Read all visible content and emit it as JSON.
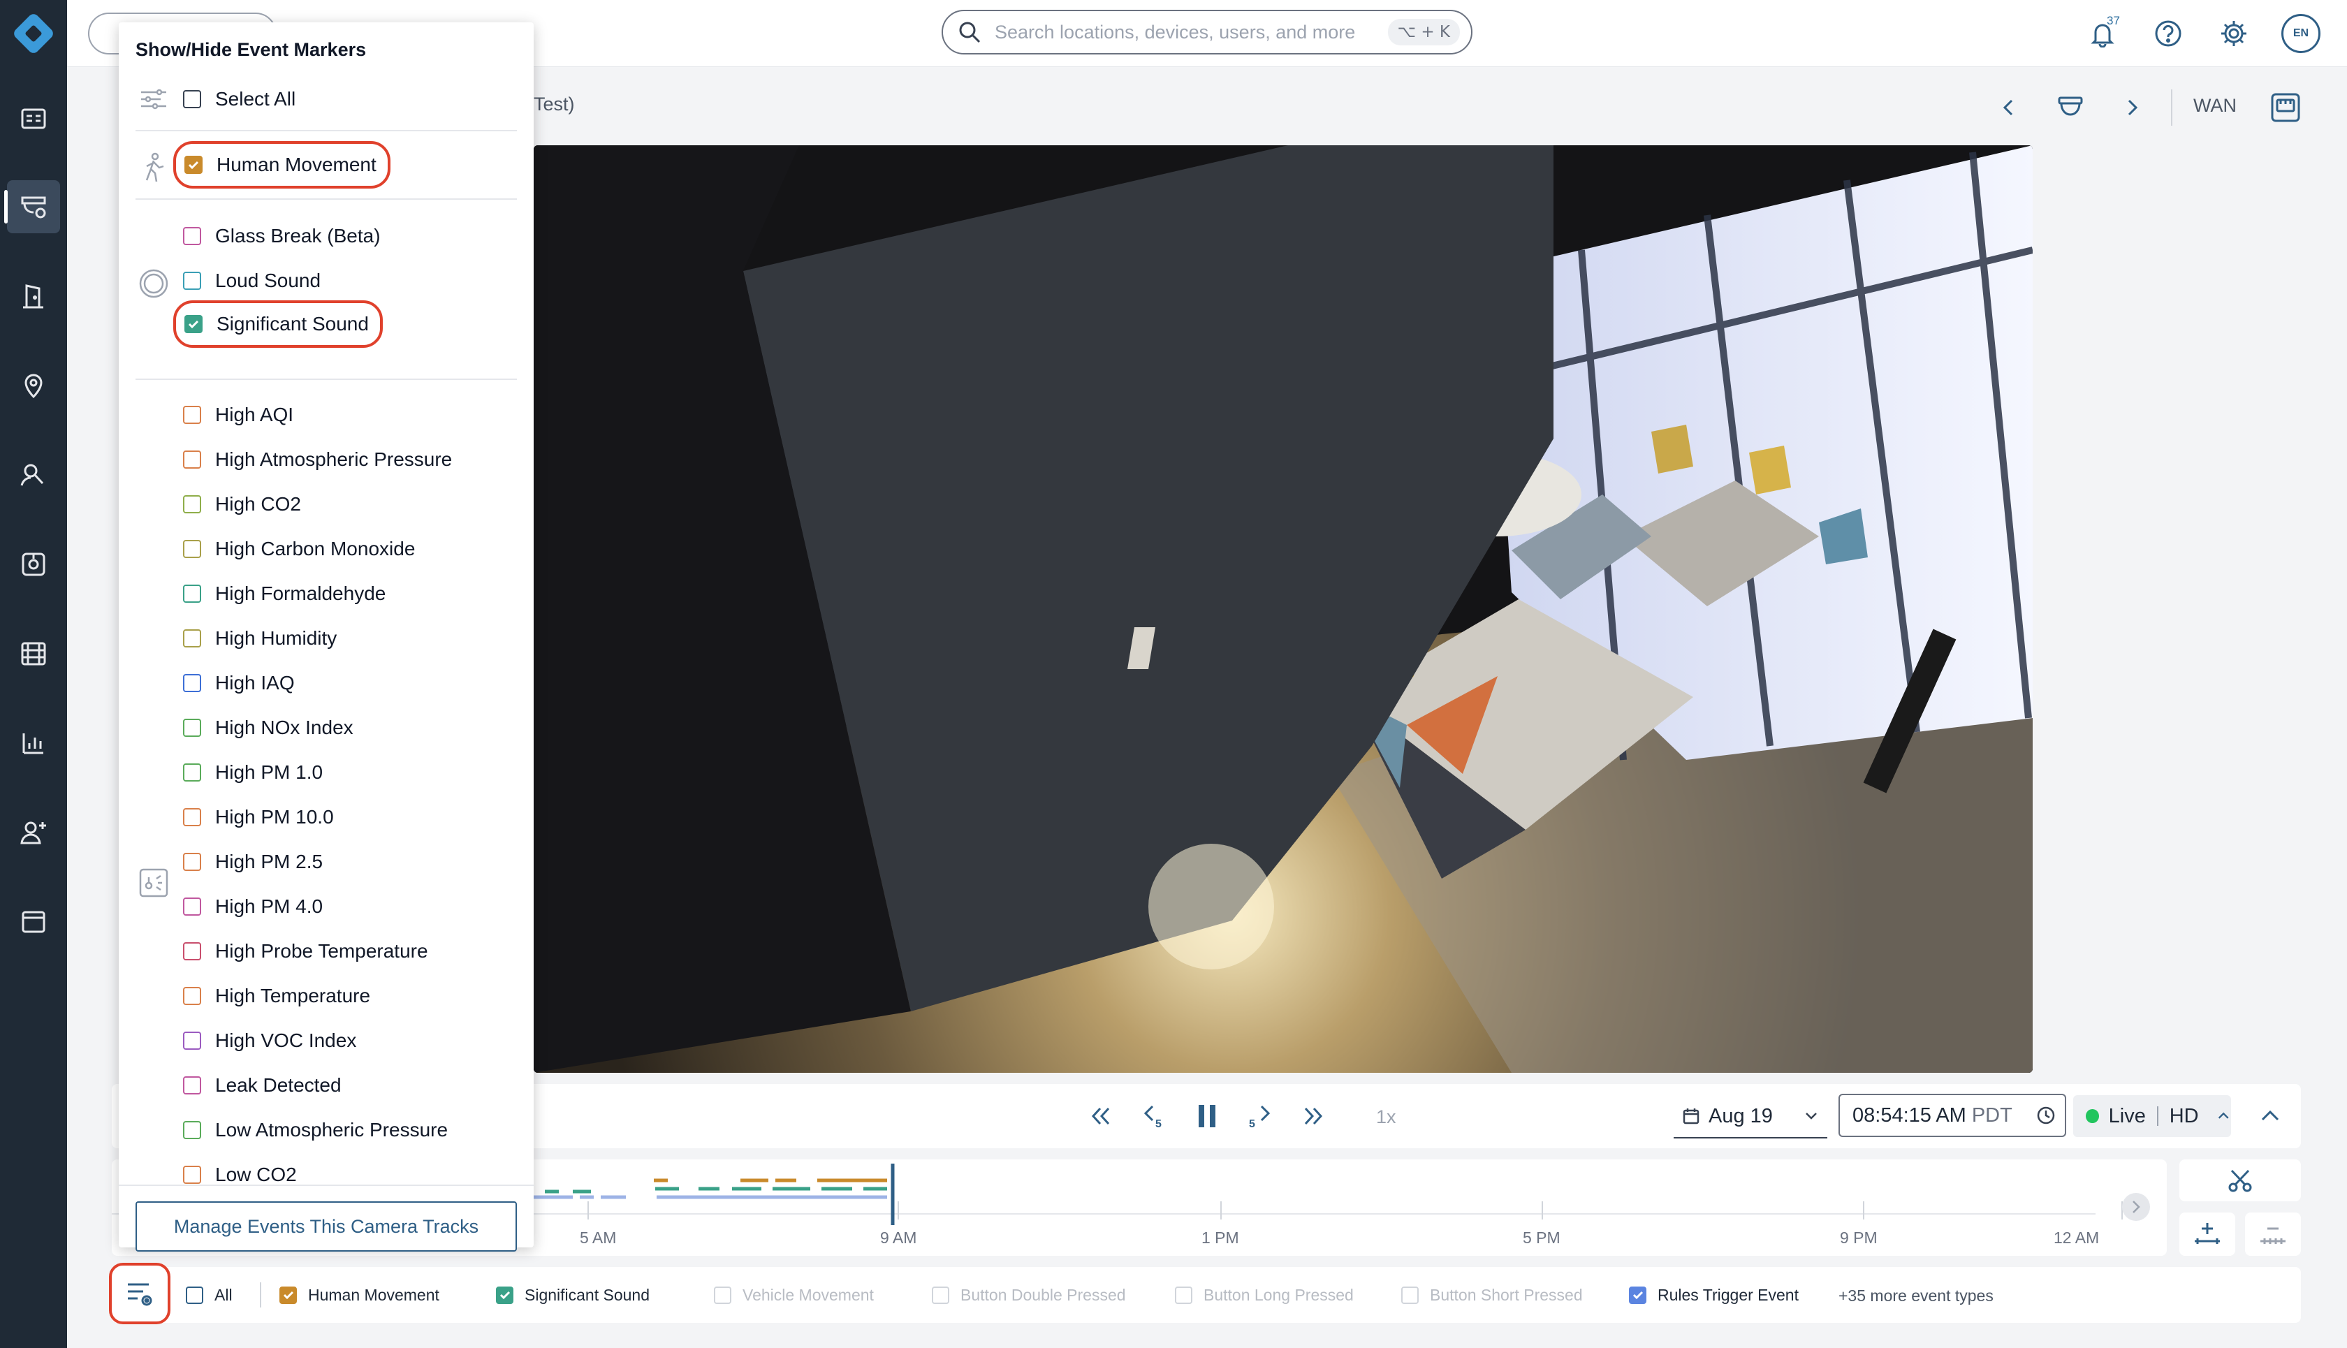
{
  "header": {
    "search": {
      "placeholder": "Search locations, devices, users, and more",
      "shortcut": "⌥ + K"
    },
    "notification_count": "37",
    "avatar_initials": "EN"
  },
  "camera": {
    "title_fragment": "Test)",
    "network_label": "WAN"
  },
  "playback": {
    "speed": "1x",
    "date": "Aug 19",
    "time": "08:54:15 AM",
    "timezone": "PDT",
    "live_label": "Live",
    "quality_label": "HD"
  },
  "timeline": {
    "labels": [
      "5 AM",
      "9 AM",
      "1 PM",
      "5 PM",
      "9 PM",
      "12 AM"
    ]
  },
  "marker_panel": {
    "title": "Show/Hide Event Markers",
    "select_all": "Select All",
    "groups": {
      "motion": [
        {
          "label": "Human Movement",
          "checked": true,
          "color": "#c98a2b"
        }
      ],
      "sound": [
        {
          "label": "Glass Break (Beta)",
          "checked": false,
          "color": "#c0589f"
        },
        {
          "label": "Loud Sound",
          "checked": false,
          "color": "#3a9fb5"
        },
        {
          "label": "Significant Sound",
          "checked": true,
          "color": "#3aa188"
        }
      ],
      "sensor": [
        {
          "label": "High AQI",
          "color": "#d9804a"
        },
        {
          "label": "High Atmospheric Pressure",
          "color": "#d9804a"
        },
        {
          "label": "High CO2",
          "color": "#8fae4a"
        },
        {
          "label": "High Carbon Monoxide",
          "color": "#a9a04a"
        },
        {
          "label": "High Formaldehyde",
          "color": "#3aa188"
        },
        {
          "label": "High Humidity",
          "color": "#a9a04a"
        },
        {
          "label": "High IAQ",
          "color": "#3d6fd6"
        },
        {
          "label": "High NOx Index",
          "color": "#5aab5a"
        },
        {
          "label": "High PM 1.0",
          "color": "#5aab5a"
        },
        {
          "label": "High PM 10.0",
          "color": "#d9804a"
        },
        {
          "label": "High PM 2.5",
          "color": "#d9804a"
        },
        {
          "label": "High PM 4.0",
          "color": "#c0589f"
        },
        {
          "label": "High Probe Temperature",
          "color": "#c94f6d"
        },
        {
          "label": "High Temperature",
          "color": "#d9804a"
        },
        {
          "label": "High VOC Index",
          "color": "#9b5bc0"
        },
        {
          "label": "Leak Detected",
          "color": "#c0589f"
        },
        {
          "label": "Low Atmospheric Pressure",
          "color": "#5aab5a"
        },
        {
          "label": "Low CO2",
          "color": "#d9804a"
        }
      ]
    },
    "manage_button": "Manage Events This Camera Tracks"
  },
  "filter_bar": {
    "all_label": "All",
    "chips": [
      {
        "label": "Human Movement",
        "state": "checked-human"
      },
      {
        "label": "Significant Sound",
        "state": "checked-sound"
      },
      {
        "label": "Vehicle Movement",
        "state": "disabled"
      },
      {
        "label": "Button Double Pressed",
        "state": "disabled"
      },
      {
        "label": "Button Long Pressed",
        "state": "disabled"
      },
      {
        "label": "Button Short Pressed",
        "state": "disabled"
      },
      {
        "label": "Rules Trigger Event",
        "state": "checked-rules"
      }
    ],
    "more_label": "+35 more event types"
  },
  "colors": {
    "accent": "#2f5f86",
    "highlight": "#e0412c",
    "sidebar_bg": "#1f2a36"
  }
}
